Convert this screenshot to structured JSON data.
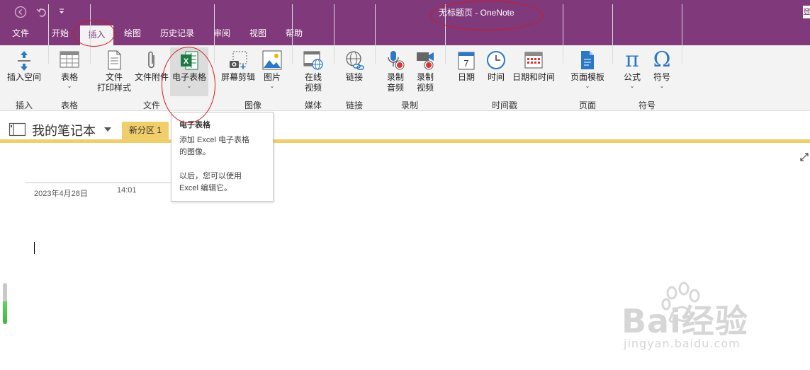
{
  "window": {
    "title": "无标题页  -  OneNote",
    "sign_in": "登"
  },
  "tabs": [
    "文件",
    "开始",
    "插入",
    "绘图",
    "历史记录",
    "审阅",
    "视图",
    "帮助"
  ],
  "active_tab": "插入",
  "ribbon": {
    "groups": {
      "insert": "插入",
      "table": "表格",
      "file": "文件",
      "image": "图像",
      "media": "媒体",
      "link": "链接",
      "record": "录制",
      "timestamp": "时间戳",
      "page": "页面",
      "symbol": "符号"
    },
    "buttons": {
      "insert_space": "插入空间",
      "table": "表格",
      "file_printout_1": "文件",
      "file_printout_2": "打印样式",
      "file_attachment": "文件附件",
      "spreadsheet": "电子表格",
      "screen_clipping": "屏幕剪辑",
      "pictures": "图片",
      "online_video_1": "在线",
      "online_video_2": "视频",
      "link": "链接",
      "record_audio_1": "录制",
      "record_audio_2": "音频",
      "record_video_1": "录制",
      "record_video_2": "视频",
      "date": "日期",
      "time": "时间",
      "date_and_time": "日期和时间",
      "page_templates": "页面模板",
      "equation": "公式",
      "symbol": "符号"
    },
    "icons": {
      "equation_glyph": "π",
      "symbol_glyph": "Ω",
      "calendar_day": "7",
      "excel_letter": "X"
    }
  },
  "notebook": {
    "name": "我的笔记本",
    "section": "新分区 1"
  },
  "page": {
    "date": "2023年4月28日",
    "time": "14:01"
  },
  "tooltip": {
    "title": "电子表格",
    "line1": "添加 Excel 电子表格",
    "line2": "的图像。",
    "line3": "以后，您可以使用",
    "line4": "Excel 编辑它。"
  },
  "watermark": {
    "brand": "Bai经验",
    "url": "jingyan.baidu.com"
  },
  "colors": {
    "onenote_purple": "#80397B",
    "section_yellow": "#F0CF6A",
    "annotation_red": "#D31A1A",
    "excel_green": "#1D7A45"
  }
}
